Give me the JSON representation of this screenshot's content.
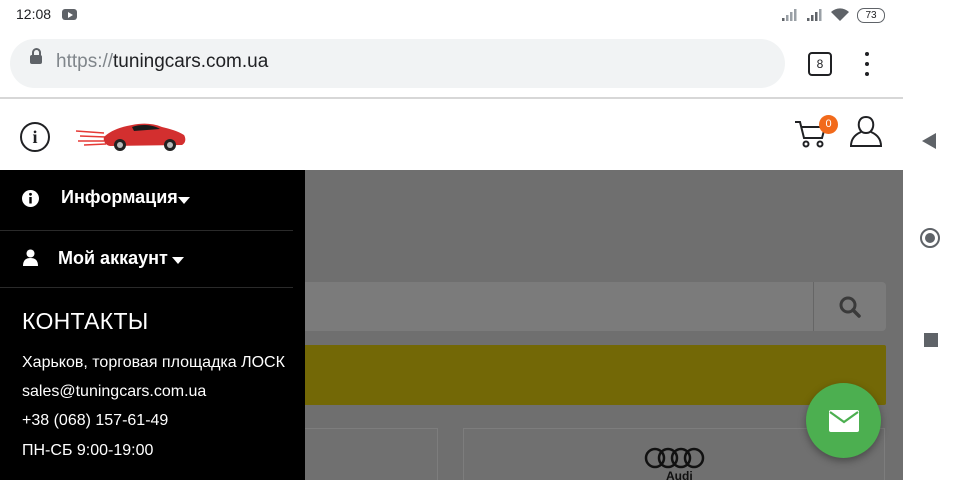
{
  "status_bar": {
    "time": "12:08",
    "battery": "73",
    "icons": [
      "youtube-icon",
      "signal-icon",
      "signal-icon",
      "wifi-icon",
      "battery-icon"
    ]
  },
  "browser": {
    "url_protocol": "https://",
    "url_host": "tuningcars.com.ua",
    "tab_count": "8"
  },
  "site_header": {
    "cart_count": "0",
    "icons": [
      "info-icon",
      "logo-car",
      "cart-icon",
      "user-icon"
    ]
  },
  "drawer": {
    "menu": [
      {
        "label": "Информация",
        "icon": "info-icon"
      },
      {
        "label": "Мой аккаунт",
        "icon": "user-icon"
      }
    ],
    "contacts_title": "КОНТАКТЫ",
    "contacts": [
      "Харьков, торговая площадка ЛОСК",
      "sales@tuningcars.com.ua",
      "+38 (068) 157-61-49",
      "ПН-СБ 9:00-19:00"
    ]
  },
  "background_content": {
    "brand_card_text": "Audi"
  },
  "colors": {
    "drawer_bg": "#000000",
    "overlay": "#6f6f6f",
    "cart_badge": "#f26a1b",
    "fab": "#4caf50",
    "url_bar_bg": "#f1f3f4"
  }
}
